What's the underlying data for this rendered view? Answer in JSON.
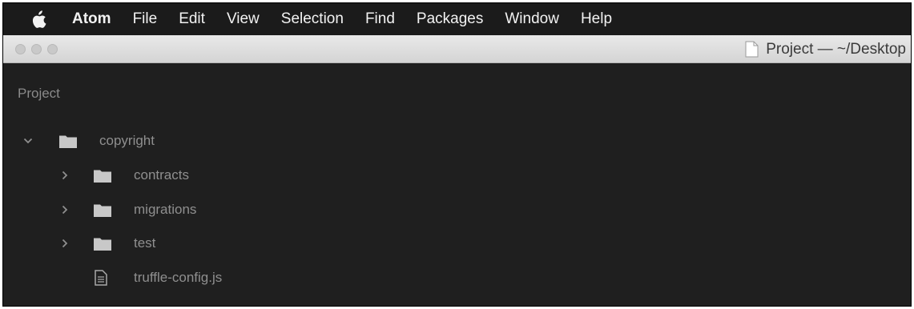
{
  "menubar": {
    "app_name": "Atom",
    "items": [
      "File",
      "Edit",
      "View",
      "Selection",
      "Find",
      "Packages",
      "Window",
      "Help"
    ]
  },
  "window": {
    "title": "Project — ~/Desktop"
  },
  "tree": {
    "panel_title": "Project",
    "root": {
      "label": "copyright",
      "expanded": true,
      "children": [
        {
          "label": "contracts",
          "type": "folder",
          "expanded": false
        },
        {
          "label": "migrations",
          "type": "folder",
          "expanded": false
        },
        {
          "label": "test",
          "type": "folder",
          "expanded": false
        },
        {
          "label": "truffle-config.js",
          "type": "file"
        }
      ]
    }
  },
  "colors": {
    "sidebar_bg": "#1f1f1f",
    "menubar_bg": "#1b1b1b",
    "tree_text": "#8f8f8f",
    "icon_fill": "#c8c8c8"
  }
}
